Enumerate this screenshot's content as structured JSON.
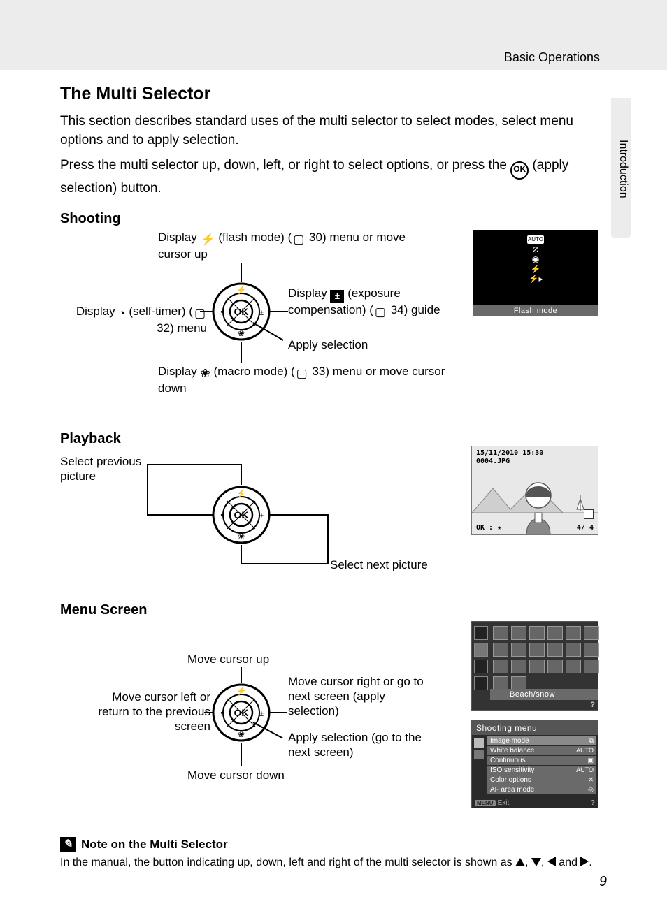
{
  "header": {
    "section": "Basic Operations",
    "side_tab": "Introduction"
  },
  "title": "The Multi Selector",
  "intro": "This section describes standard uses of the multi selector to select modes, select menu options and to apply selection.",
  "intro2_pre": "Press the multi selector up, down, left, or right to select options, or press the ",
  "intro2_post": " (apply selection) button.",
  "ok_glyph": "OK",
  "shooting": {
    "heading": "Shooting",
    "top_pre": "Display ",
    "top_flash": "⚡",
    "top_mid": " (flash mode) (",
    "top_ref": "30",
    "top_post": ") menu or move cursor up",
    "left_pre": "Display ",
    "left_timer": "◔",
    "left_mid": " (self-timer) (",
    "left_ref": "32",
    "left_post": ") menu",
    "right_pre": "Display ",
    "right_ec": "±",
    "right_mid": " (exposure compensation) (",
    "right_ref": "34",
    "right_post": ") guide",
    "apply": "Apply selection",
    "bottom_pre": "Display ",
    "bottom_macro": "❀",
    "bottom_mid": " (macro mode) (",
    "bottom_ref": "33",
    "bottom_post": ") menu or move cursor down",
    "flash_strip": "Flash mode",
    "flash_chip": "AUTO"
  },
  "playback": {
    "heading": "Playback",
    "prev": "Select previous picture",
    "next": "Select next picture",
    "date": "15/11/2010 15:30",
    "file": "0004.JPG",
    "okstar": "OK : ★",
    "count": "4/   4"
  },
  "menuscreen": {
    "heading": "Menu Screen",
    "up": "Move cursor up",
    "right": "Move cursor right or go to next screen (apply selection)",
    "left": "Move cursor left or return to the previous screen",
    "apply": "Apply selection (go to the next screen)",
    "down": "Move cursor down",
    "scene_label": "Beach/snow",
    "shoot_title": "Shooting menu",
    "rows": [
      {
        "label": "Image mode",
        "value": "⧉"
      },
      {
        "label": "White balance",
        "value": "AUTO"
      },
      {
        "label": "Continuous",
        "value": "▣"
      },
      {
        "label": "ISO sensitivity",
        "value": "AUTO"
      },
      {
        "label": "Color options",
        "value": "✕"
      },
      {
        "label": "AF area mode",
        "value": "◎"
      }
    ],
    "exit_menu": "MENU",
    "exit_label": "Exit"
  },
  "note": {
    "title": "Note on the Multi Selector",
    "body_pre": "In the manual, the button indicating up, down, left and right of the multi selector is shown as ",
    "body_sep": ", ",
    "body_and": " and ",
    "body_end": "."
  },
  "page_number": "9"
}
